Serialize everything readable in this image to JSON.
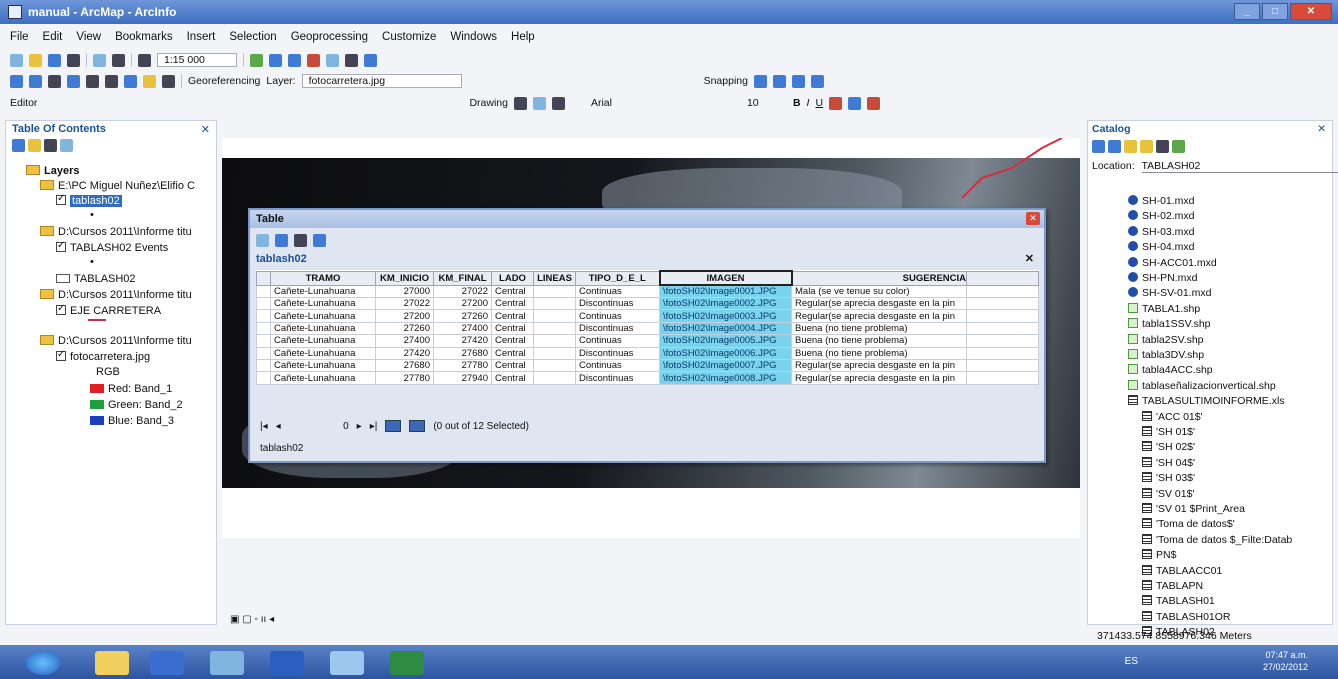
{
  "window": {
    "title": "manual - ArcMap - ArcInfo"
  },
  "menu": [
    "File",
    "Edit",
    "View",
    "Bookmarks",
    "Insert",
    "Selection",
    "Geoprocessing",
    "Customize",
    "Windows",
    "Help"
  ],
  "toolbar": {
    "scale": "1:15 000",
    "georef_label": "Georeferencing",
    "layer_label": "Layer:",
    "layer_value": "fotocarretera.jpg",
    "snapping_label": "Snapping",
    "editor_label": "Editor",
    "drawing_label": "Drawing",
    "font_name": "Arial",
    "font_size": "10"
  },
  "toc": {
    "title": "Table Of Contents",
    "layers_label": "Layers",
    "items": [
      {
        "label": "E:\\PC Miguel Nuñez\\Elifio C"
      },
      {
        "label": "tablash02"
      },
      {
        "label": "D:\\Cursos 2011\\Informe titu"
      },
      {
        "label": "TABLASH02 Events"
      },
      {
        "label": "TABLASH02"
      },
      {
        "label": "D:\\Cursos 2011\\Informe titu"
      },
      {
        "label": "EJE CARRETERA"
      },
      {
        "label": "D:\\Cursos 2011\\Informe titu"
      },
      {
        "label": "fotocarretera.jpg"
      },
      {
        "label": "RGB"
      },
      {
        "label": "Red:   Band_1"
      },
      {
        "label": "Green: Band_2"
      },
      {
        "label": "Blue:  Band_3"
      }
    ],
    "band_colors": {
      "red": "#e02020",
      "green": "#1fa038",
      "blue": "#1c3fbf"
    }
  },
  "table": {
    "window_title": "Table",
    "tab_name": "tablash02",
    "columns": [
      "TRAMO",
      "KM_INICIO",
      "KM_FINAL",
      "LADO",
      "LINEAS",
      "TIPO_D_E_L",
      "IMAGEN",
      "SUGERENCIA"
    ],
    "rows": [
      [
        "Cañete-Lunahuana",
        "27000",
        "27022",
        "Central",
        "",
        "Continuas",
        "\\fotoSH02\\Image0001.JPG",
        "Mala (se ve tenue su color)"
      ],
      [
        "Cañete-Lunahuana",
        "27022",
        "27200",
        "Central",
        "",
        "Discontinuas",
        "\\fotoSH02\\Image0002.JPG",
        "Regular(se aprecia desgaste en la pin"
      ],
      [
        "Cañete-Lunahuana",
        "27200",
        "27260",
        "Central",
        "",
        "Continuas",
        "\\fotoSH02\\Image0003.JPG",
        "Regular(se aprecia desgaste en la pin"
      ],
      [
        "Cañete-Lunahuana",
        "27260",
        "27400",
        "Central",
        "",
        "Discontinuas",
        "\\fotoSH02\\Image0004.JPG",
        "Buena (no tiene problema)"
      ],
      [
        "Cañete-Lunahuana",
        "27400",
        "27420",
        "Central",
        "",
        "Continuas",
        "\\fotoSH02\\Image0005.JPG",
        "Buena (no tiene problema)"
      ],
      [
        "Cañete-Lunahuana",
        "27420",
        "27680",
        "Central",
        "",
        "Discontinuas",
        "\\fotoSH02\\Image0006.JPG",
        "Buena (no tiene problema)"
      ],
      [
        "Cañete-Lunahuana",
        "27680",
        "27780",
        "Central",
        "",
        "Continuas",
        "\\fotoSH02\\Image0007.JPG",
        "Regular(se aprecia desgaste en la pin"
      ],
      [
        "Cañete-Lunahuana",
        "27780",
        "27940",
        "Central",
        "",
        "Discontinuas",
        "\\fotoSH02\\Image0008.JPG",
        "Regular(se aprecia desgaste en la pin"
      ]
    ],
    "record_num": "0",
    "selection_status": "(0 out of 12 Selected)",
    "footer_tab": "tablash02"
  },
  "catalog": {
    "title": "Catalog",
    "location_label": "Location:",
    "location_value": "TABLASH02",
    "items": [
      {
        "label": "SH-01.mxd",
        "icon": "mxd"
      },
      {
        "label": "SH-02.mxd",
        "icon": "mxd"
      },
      {
        "label": "SH-03.mxd",
        "icon": "mxd"
      },
      {
        "label": "SH-04.mxd",
        "icon": "mxd"
      },
      {
        "label": "SH-ACC01.mxd",
        "icon": "mxd"
      },
      {
        "label": "SH-PN.mxd",
        "icon": "mxd"
      },
      {
        "label": "SH-SV-01.mxd",
        "icon": "mxd"
      },
      {
        "label": "TABLA1.shp",
        "icon": "shp"
      },
      {
        "label": "tabla1SSV.shp",
        "icon": "shp"
      },
      {
        "label": "tabla2SV.shp",
        "icon": "shp"
      },
      {
        "label": "tabla3DV.shp",
        "icon": "shp"
      },
      {
        "label": "tabla4ACC.shp",
        "icon": "shp"
      },
      {
        "label": "tablaseñalizacionvertical.shp",
        "icon": "shp"
      },
      {
        "label": "TABLASULTIMOINFORME.xls",
        "icon": "xls"
      },
      {
        "label": "'ACC 01$'",
        "icon": "tbl"
      },
      {
        "label": "'SH 01$'",
        "icon": "tbl"
      },
      {
        "label": "'SH 02$'",
        "icon": "tbl"
      },
      {
        "label": "'SH 04$'",
        "icon": "tbl"
      },
      {
        "label": "'SH 03$'",
        "icon": "tbl"
      },
      {
        "label": "'SV 01$'",
        "icon": "tbl"
      },
      {
        "label": "'SV 01 $Print_Area",
        "icon": "tbl"
      },
      {
        "label": "'Toma de datos$'",
        "icon": "tbl"
      },
      {
        "label": "'Toma de datos $_Filte:Datab",
        "icon": "tbl"
      },
      {
        "label": "PN$",
        "icon": "tbl"
      },
      {
        "label": "TABLAACC01",
        "icon": "tbl"
      },
      {
        "label": "TABLAPN",
        "icon": "tbl"
      },
      {
        "label": "TABLASH01",
        "icon": "tbl"
      },
      {
        "label": "TABLASH01OR",
        "icon": "tbl"
      },
      {
        "label": "TABLASH02",
        "icon": "tbl"
      }
    ]
  },
  "status": {
    "coordinates": "371433.574  8558976.346 Meters"
  },
  "taskbar": {
    "lang": "ES",
    "time": "07:47 a.m.",
    "date": "27/02/2012"
  }
}
